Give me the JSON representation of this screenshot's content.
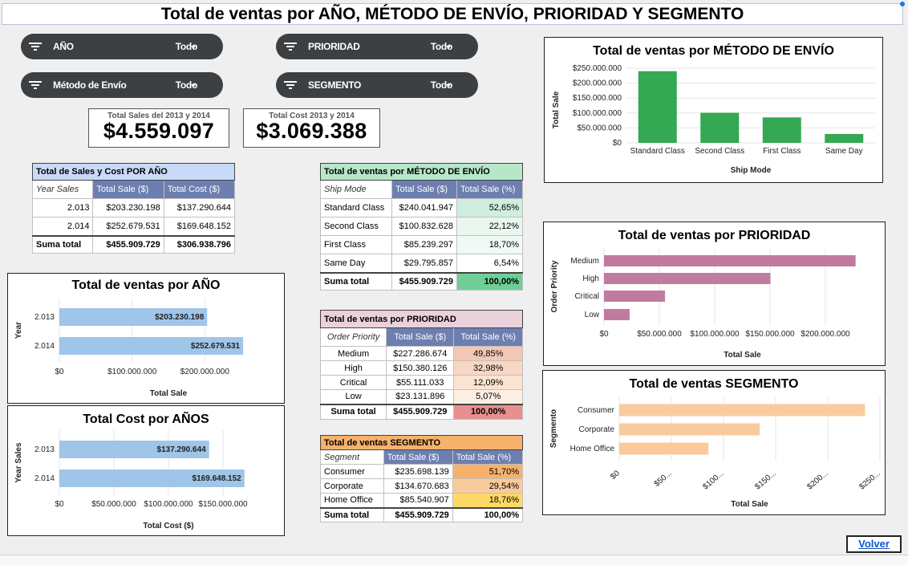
{
  "title": "Total de ventas por AÑO, MÉTODO DE ENVÍO, PRIORIDAD Y SEGMENTO",
  "filters": [
    {
      "label": "AÑO",
      "value": "Todo",
      "icon": "filter-icon"
    },
    {
      "label": "PRIORIDAD",
      "value": "Todo",
      "icon": "filter-icon"
    },
    {
      "label": "Método de Envío",
      "value": "Todo",
      "icon": "filter-icon"
    },
    {
      "label": "SEGMENTO",
      "value": "Todo",
      "icon": "filter-icon"
    }
  ],
  "kpis": {
    "sales": {
      "label": "Total Sales del 2013 y 2014",
      "value": "$4.559.097"
    },
    "cost": {
      "label": "Total Cost 2013 y 2014",
      "value": "$3.069.388"
    }
  },
  "table_year": {
    "header": "Total de Sales y Cost POR AÑO",
    "columns": [
      "Year Sales",
      "Total Sale ($)",
      "Total Cost ($)"
    ],
    "rows": [
      [
        "2.013",
        "$203.230.198",
        "$137.290.644"
      ],
      [
        "2.014",
        "$252.679.531",
        "$169.648.152"
      ]
    ],
    "total": [
      "Suma total",
      "$455.909.729",
      "$306.938.796"
    ]
  },
  "table_ship": {
    "header": "Total de ventas por MÉTODO DE ENVÍO",
    "columns": [
      "Ship Mode",
      "Total Sale ($)",
      "Total Sale (%)"
    ],
    "rows": [
      [
        "Standard Class",
        "$240.041.947",
        "52,65%"
      ],
      [
        "Second Class",
        "$100.832.628",
        "22,12%"
      ],
      [
        "First Class",
        "$85.239.297",
        "18,70%"
      ],
      [
        "Same Day",
        "$29.795.857",
        "6,54%"
      ]
    ],
    "total": [
      "Suma total",
      "$455.909.729",
      "100,00%"
    ]
  },
  "table_priority": {
    "header": "Total de ventas por PRIORIDAD",
    "columns": [
      "Order Priority",
      "Total Sale ($)",
      "Total Sale (%)"
    ],
    "rows": [
      [
        "Medium",
        "$227.286.674",
        "49,85%"
      ],
      [
        "High",
        "$150.380.126",
        "32,98%"
      ],
      [
        "Critical",
        "$55.111.033",
        "12,09%"
      ],
      [
        "Low",
        "$23.131.896",
        "5,07%"
      ]
    ],
    "total": [
      "Suma total",
      "$455.909.729",
      "100,00%"
    ]
  },
  "table_segment": {
    "header": "Total de ventas SEGMENTO",
    "columns": [
      "Segment",
      "Total Sale ($)",
      "Total Sale (%)"
    ],
    "rows": [
      [
        "Consumer",
        "$235.698.139",
        "51,70%"
      ],
      [
        "Corporate",
        "$134.670.683",
        "29,54%"
      ],
      [
        "Home Office",
        "$85.540.907",
        "18,76%"
      ]
    ],
    "total": [
      "Suma total",
      "$455.909.729",
      "100,00%"
    ]
  },
  "colors": {
    "year_header": "#c9daf8",
    "year_cols": "#6d7fb0",
    "ship_header": "#b6e7c9",
    "ship_cols": "#6d7fb0",
    "prio_header": "#ead1dc",
    "prio_cols": "#6d7fb0",
    "seg_header": "#f9cb9c",
    "seg_cols": "#6d7fb0",
    "bar_blue": "#9fc5e8",
    "bar_green": "#34a853",
    "bar_pink": "#c27ba0",
    "bar_orange": "#f9cb9c"
  },
  "volver": "Volver",
  "chart_data": [
    {
      "type": "bar",
      "orientation": "horizontal",
      "title": "Total de ventas por AÑO",
      "xlabel": "Total Sale",
      "ylabel": "Year",
      "categories": [
        "2.013",
        "2.014"
      ],
      "values": [
        203230198,
        252679531
      ],
      "data_labels": [
        "$203.230.198",
        "$252.679.531"
      ],
      "xticks": [
        "$0",
        "$100.000.000",
        "$200.000.000"
      ],
      "xlim": [
        0,
        300000000
      ],
      "grid": true
    },
    {
      "type": "bar",
      "orientation": "horizontal",
      "title": "Total Cost por AÑOS",
      "xlabel": "Total Cost ($)",
      "ylabel": "Year Sales",
      "categories": [
        "2.013",
        "2.014"
      ],
      "values": [
        137290644,
        169648152
      ],
      "data_labels": [
        "$137.290.644",
        "$169.648.152"
      ],
      "xticks": [
        "$0",
        "$50.000.000",
        "$100.000.000",
        "$150.000.000"
      ],
      "xlim": [
        0,
        200000000
      ],
      "grid": true
    },
    {
      "type": "bar",
      "orientation": "vertical",
      "title": "Total de ventas por MÉTODO DE ENVÍO",
      "xlabel": "Ship Mode",
      "ylabel": "Total Sale",
      "categories": [
        "Standard Class",
        "Second Class",
        "First Class",
        "Same Day"
      ],
      "values": [
        240041947,
        100832628,
        85239297,
        29795857
      ],
      "yticks": [
        "$0",
        "$50.000.000",
        "$100.000.000",
        "$150.000.000",
        "$200.000.000",
        "$250.000.000"
      ],
      "ylim": [
        0,
        250000000
      ],
      "grid": true
    },
    {
      "type": "bar",
      "orientation": "horizontal",
      "title": "Total de ventas por PRIORIDAD",
      "xlabel": "Total Sale",
      "ylabel": "Order Priority",
      "categories": [
        "Medium",
        "High",
        "Critical",
        "Low"
      ],
      "values": [
        227286674,
        150380126,
        55111033,
        23131896
      ],
      "xticks": [
        "$0",
        "$50.000.000",
        "$100.000.000",
        "$150.000.000",
        "$200.000.000"
      ],
      "xlim": [
        0,
        250000000
      ],
      "grid": true
    },
    {
      "type": "bar",
      "orientation": "horizontal",
      "title": "Total de ventas SEGMENTO",
      "xlabel": "Total Sale",
      "ylabel": "Segmento",
      "categories": [
        "Consumer",
        "Corporate",
        "Home Office"
      ],
      "values": [
        235698139,
        134670683,
        85540907
      ],
      "xticks": [
        "$0",
        "$50...",
        "$100...",
        "$150...",
        "$200...",
        "$250..."
      ],
      "xlim": [
        0,
        250000000
      ],
      "grid": true
    }
  ]
}
